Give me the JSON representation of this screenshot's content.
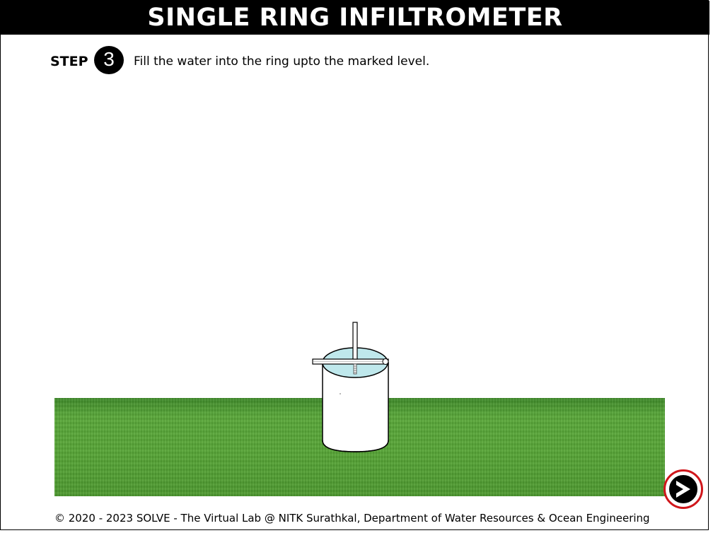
{
  "header": {
    "title": "SINGLE RING INFILTROMETER"
  },
  "step": {
    "label": "STEP",
    "number": "3",
    "instruction": "Fill the water into the ring upto the marked level."
  },
  "scene": {
    "ground": "grass",
    "apparatus": "single ring infiltrometer with measuring gauge",
    "water_color": "#bfe8ec"
  },
  "navigation": {
    "next_icon": "next-arrow-icon",
    "accent_color": "#d0161b"
  },
  "footer": {
    "copyright": "© 2020 - 2023 SOLVE - The Virtual Lab @ NITK Surathkal, Department of Water Resources & Ocean Engineering"
  }
}
